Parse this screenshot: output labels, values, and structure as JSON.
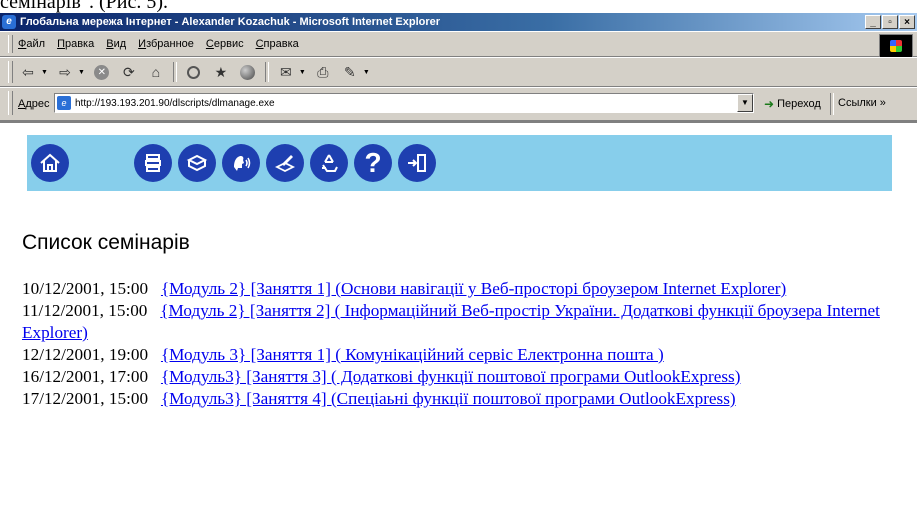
{
  "caption_partial": "семінарів\". (Рис. 5).",
  "window": {
    "title": "Глобальна мережа Інтернет - Alexander Kozachuk - Microsoft Internet Explorer",
    "btn_min": "_",
    "btn_max": "▫",
    "btn_close": "×"
  },
  "menu": {
    "items": [
      "Файл",
      "Правка",
      "Вид",
      "Избранное",
      "Сервис",
      "Справка"
    ]
  },
  "address": {
    "label": "Адрес",
    "url": "http://193.193.201.90/dlscripts/dlmanage.exe",
    "go_label": "Переход",
    "links_label": "Ссылки »"
  },
  "nav_icons": [
    "home-icon",
    "library-icon",
    "books-icon",
    "talk-icon",
    "write-icon",
    "recycle-icon",
    "help-icon",
    "exit-icon"
  ],
  "colors": {
    "nav_strip": "#87CEEB",
    "nav_icon": "#1E3FB0",
    "link": "#0000EE"
  },
  "page": {
    "heading": "Список семінарів",
    "seminars": [
      {
        "date": "10/12/2001, 15:00",
        "title": "{Модуль 2} [Заняття 1] (Основи навігації у Веб-просторі броузером Internet Explorer)"
      },
      {
        "date": "11/12/2001, 15:00",
        "title": "{Модуль 2} [Заняття 2] ( Інформаційний Веб-простір України. Додаткові функції броузера Internet Explorer)"
      },
      {
        "date": "12/12/2001, 19:00",
        "title": "{Модуль 3} [Заняття 1] ( Комунікаційний сервіс Електронна пошта )"
      },
      {
        "date": "16/12/2001, 17:00",
        "title": "{Модуль3} [Заняття 3] ( Додаткові функції поштової програми OutlookExpress)"
      },
      {
        "date": "17/12/2001, 15:00",
        "title": "{Модуль3} [Заняття 4] (Спеціаьні функції поштової програми OutlookExpress)"
      }
    ]
  }
}
